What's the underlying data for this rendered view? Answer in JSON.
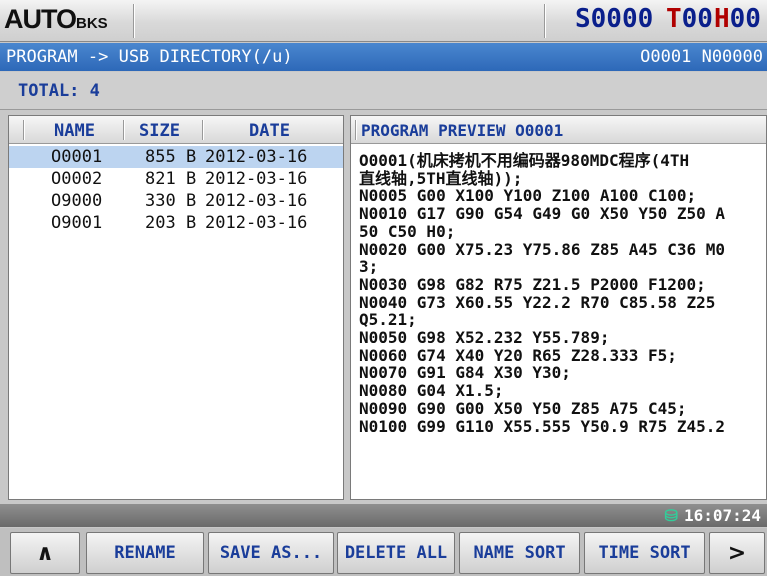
{
  "header": {
    "mode": "AUTO",
    "mode_sub": "BKS",
    "s_value": "S0000",
    "t_label": "T",
    "t_value": "00",
    "h_label": "H",
    "h_value": "00"
  },
  "title": {
    "path": "PROGRAM -> USB DIRECTORY(/u)",
    "program": "O0001 N00000"
  },
  "total": "TOTAL: 4",
  "file_list": {
    "columns": [
      "NAME",
      "SIZE",
      "DATE"
    ],
    "rows": [
      {
        "name": "O0001",
        "size": "855 B",
        "date": "2012-03-16"
      },
      {
        "name": "O0002",
        "size": "821 B",
        "date": "2012-03-16"
      },
      {
        "name": "O9000",
        "size": "330 B",
        "date": "2012-03-16"
      },
      {
        "name": "O9001",
        "size": "203 B",
        "date": "2012-03-16"
      }
    ],
    "selected_index": 0
  },
  "preview": {
    "title": "PROGRAM PREVIEW O0001",
    "lines": [
      "O0001(机床拷机不用编码器980MDC程序(4TH",
      "直线轴,5TH直线轴));",
      "N0005 G00 X100 Y100 Z100 A100 C100;",
      "N0010 G17 G90 G54 G49 G0 X50 Y50 Z50 A",
      "50 C50 H0;",
      "N0020 G00 X75.23 Y75.86 Z85 A45 C36 M0",
      "3;",
      "N0030 G98 G82 R75 Z21.5 P2000 F1200;",
      "N0040 G73 X60.55 Y22.2 R70 C85.58 Z25",
      "Q5.21;",
      "N0050 G98 X52.232 Y55.789;",
      "N0060 G74 X40 Y20 R65 Z28.333 F5;",
      "N0070 G91 G84 X30 Y30;",
      "N0080 G04 X1.5;",
      "N0090 G90 G00 X50 Y50 Z85 A75 C45;",
      "N0100 G99 G110 X55.555 Y50.9 R75 Z45.2"
    ]
  },
  "status": {
    "time": "16:07:24"
  },
  "softkeys": {
    "prev": "∧",
    "rename": "RENAME",
    "save_as": "SAVE AS...",
    "delete_all": "DELETE ALL",
    "name_sort": "NAME SORT",
    "time_sort": "TIME SORT",
    "next": ">"
  }
}
